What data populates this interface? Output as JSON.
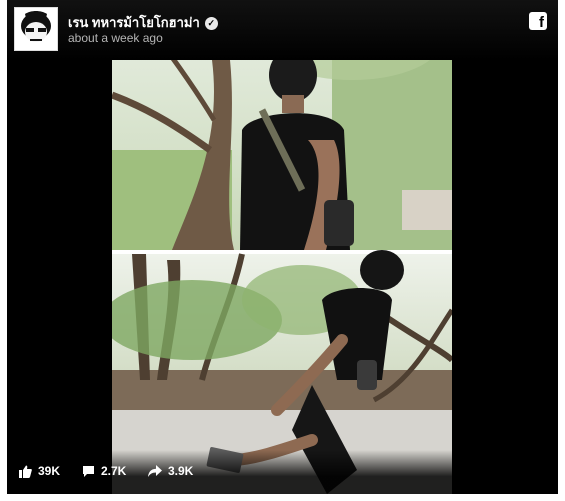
{
  "post": {
    "author": "เรน ทหารม้าโยโกฮาม่า",
    "timestamp": "about a week ago"
  },
  "stats": {
    "likes": "39K",
    "comments": "2.7K",
    "shares": "3.9K"
  },
  "icons": {
    "verified": "verified-badge-icon",
    "platform": "facebook-icon",
    "like": "thumbs-up-icon",
    "comment": "comment-icon",
    "share": "share-arrow-icon"
  },
  "colors": {
    "background": "#000000",
    "text": "#ffffff",
    "muted_text": "#b5b5b5"
  }
}
